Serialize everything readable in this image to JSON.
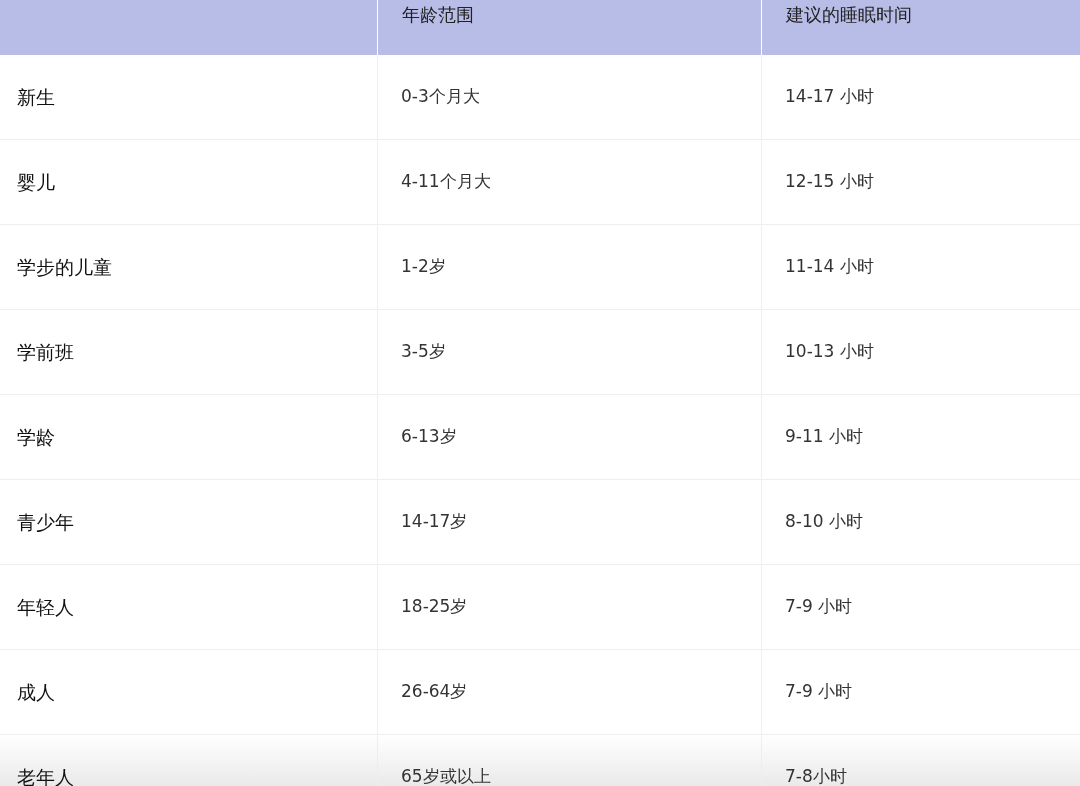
{
  "table": {
    "columns": [
      "年龄范围",
      "建议的睡眠时间"
    ],
    "rows": [
      {
        "group": "新生",
        "age": "0-3个月大",
        "sleep": "14-17 小时"
      },
      {
        "group": "婴儿",
        "age": "4-11个月大",
        "sleep": "12-15 小时"
      },
      {
        "group": "学步的儿童",
        "age": "1-2岁",
        "sleep": "11-14 小时"
      },
      {
        "group": "学前班",
        "age": "3-5岁",
        "sleep": "10-13 小时"
      },
      {
        "group": "学龄",
        "age": "6-13岁",
        "sleep": "9-11 小时"
      },
      {
        "group": "青少年",
        "age": "14-17岁",
        "sleep": "8-10 小时"
      },
      {
        "group": "年轻人",
        "age": "18-25岁",
        "sleep": "7-9 小时"
      },
      {
        "group": "成人",
        "age": "26-64岁",
        "sleep": "7-9 小时"
      },
      {
        "group": "老年人",
        "age": "65岁或以上",
        "sleep": "7-8小时"
      }
    ]
  }
}
